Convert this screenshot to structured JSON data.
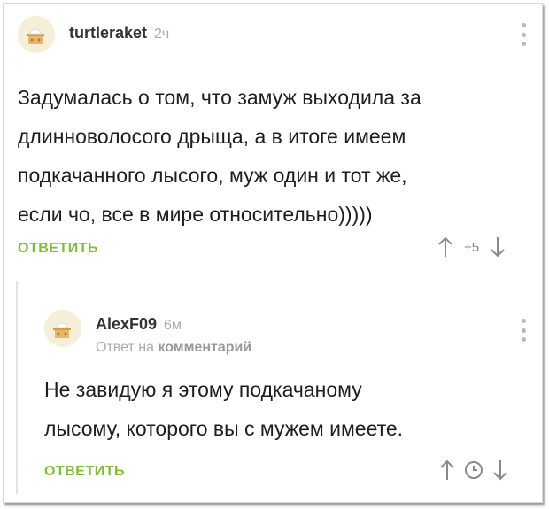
{
  "comment1": {
    "author": "turtleraket",
    "time": "2ч",
    "lines": [
      "Задумалась о том, что замуж выходила за",
      "длинноволосого дрыща, а в итоге имеем",
      "подкачанного лысого, муж один и тот же,",
      "если чо, все в мире относительно)))))"
    ],
    "reply_label": "ОТВЕТИТЬ",
    "rating": "+5"
  },
  "comment2": {
    "author": "AlexF09",
    "time": "6м",
    "reply_to_prefix": "Ответ на",
    "reply_to_link": "комментарий",
    "lines": [
      "Не завидую я этому подкачаному",
      "лысому, которого вы с мужем имеете."
    ],
    "reply_label": "ОТВЕТИТЬ"
  },
  "icons": [
    "avatar",
    "more-vertical-icon",
    "arrow-up-icon",
    "arrow-down-icon",
    "clock-icon"
  ],
  "colors": {
    "accent": "#7fbc3c",
    "text": "#1e1e1e",
    "muted": "#a9a9a9"
  }
}
